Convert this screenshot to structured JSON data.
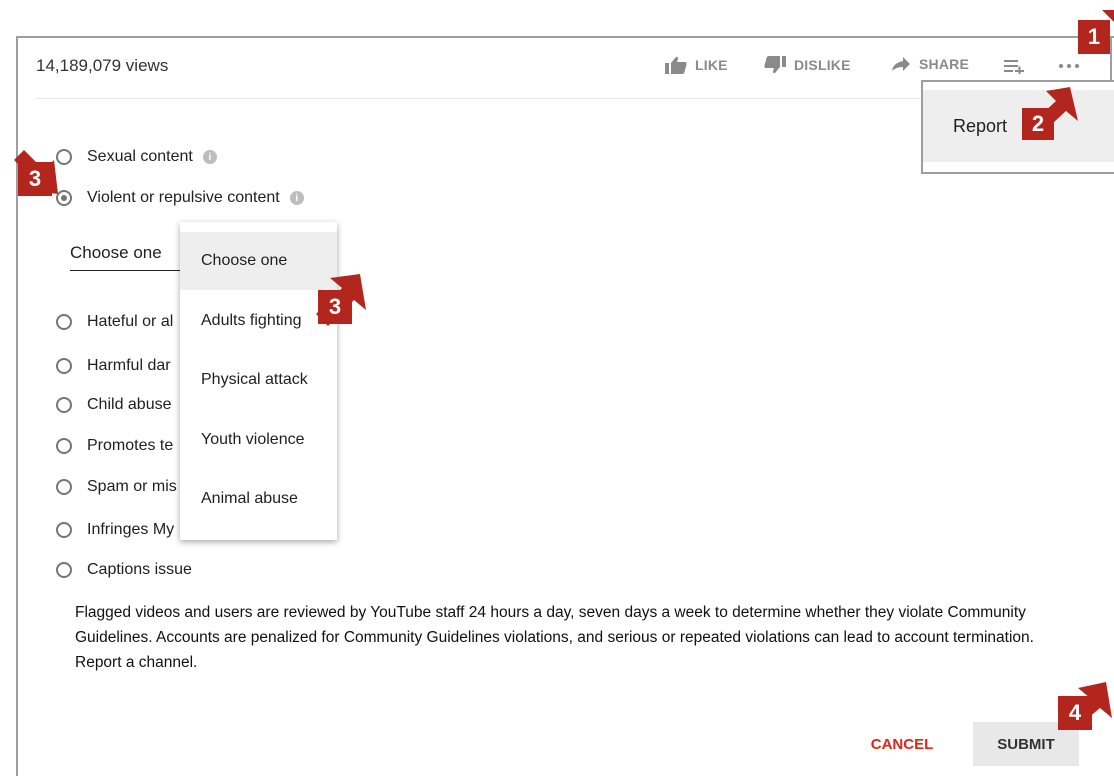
{
  "header": {
    "views": "14,189,079 views"
  },
  "actions": {
    "like": "LIKE",
    "dislike": "DISLIKE",
    "share": "SHARE"
  },
  "report_popup": {
    "label": "Report"
  },
  "radio_options": [
    {
      "label": "Sexual content",
      "checked": false
    },
    {
      "label": "Violent or repulsive content",
      "checked": true
    },
    {
      "label": "Hateful or al"
    },
    {
      "label": "Harmful dar"
    },
    {
      "label": "Child abuse"
    },
    {
      "label": "Promotes te"
    },
    {
      "label": "Spam or mis"
    },
    {
      "label": "Infringes My"
    },
    {
      "label": "Captions issue"
    }
  ],
  "select": {
    "value": "Choose one"
  },
  "dropdown": {
    "options": [
      "Choose one",
      "Adults fighting",
      "Physical attack",
      "Youth violence",
      "Animal abuse"
    ],
    "selected": "Choose one"
  },
  "note": "Flagged videos and users are reviewed by YouTube staff 24 hours a day, seven days a week to determine whether they violate Community Guidelines. Accounts are penalized for Community Guidelines violations, and serious or repeated violations can lead to account termination. Report a channel.",
  "buttons": {
    "cancel": "CANCEL",
    "submit": "SUBMIT"
  },
  "annotations": {
    "step1": "1",
    "step2": "2",
    "step3": "3",
    "step4": "4"
  },
  "colors": {
    "annotation": "#b3261e",
    "cancel": "#e62117",
    "selected_bg": "#eeeeee"
  },
  "icons": [
    "thumb-up-icon",
    "thumb-down-icon",
    "share-arrow-icon",
    "add-to-playlist-icon",
    "more-icon",
    "info-icon"
  ]
}
